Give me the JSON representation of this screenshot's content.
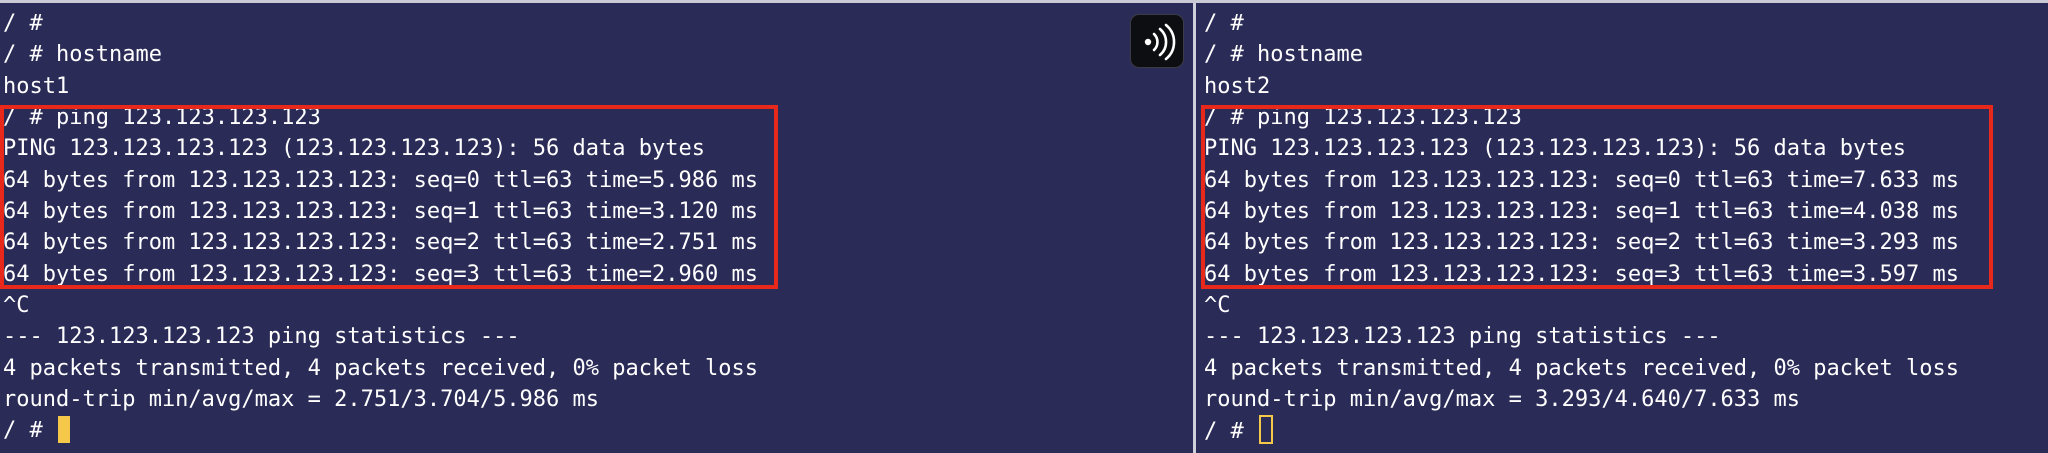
{
  "left_pane": {
    "lines": [
      "/ #",
      "/ # hostname",
      "host1",
      "/ # ping 123.123.123.123",
      "PING 123.123.123.123 (123.123.123.123): 56 data bytes",
      "64 bytes from 123.123.123.123: seq=0 ttl=63 time=5.986 ms",
      "64 bytes from 123.123.123.123: seq=1 ttl=63 time=3.120 ms",
      "64 bytes from 123.123.123.123: seq=2 ttl=63 time=2.751 ms",
      "64 bytes from 123.123.123.123: seq=3 ttl=63 time=2.960 ms",
      "^C",
      "--- 123.123.123.123 ping statistics ---",
      "4 packets transmitted, 4 packets received, 0% packet loss",
      "round-trip min/avg/max = 2.751/3.704/5.986 ms"
    ],
    "prompt": "/ # "
  },
  "right_pane": {
    "lines": [
      "/ #",
      "/ # hostname",
      "host2",
      "/ # ping 123.123.123.123",
      "PING 123.123.123.123 (123.123.123.123): 56 data bytes",
      "64 bytes from 123.123.123.123: seq=0 ttl=63 time=7.633 ms",
      "64 bytes from 123.123.123.123: seq=1 ttl=63 time=4.038 ms",
      "64 bytes from 123.123.123.123: seq=2 ttl=63 time=3.293 ms",
      "64 bytes from 123.123.123.123: seq=3 ttl=63 time=3.597 ms",
      "^C",
      "--- 123.123.123.123 ping statistics ---",
      "4 packets transmitted, 4 packets received, 0% packet loss",
      "round-trip min/avg/max = 3.293/4.640/7.633 ms"
    ],
    "prompt": "/ # "
  },
  "broadcast_icon": "broadcast-input-icon",
  "colors": {
    "background": "#2a2b57",
    "text": "#ffffff",
    "cursor": "#f5c84a",
    "highlight": "#e8281b"
  }
}
